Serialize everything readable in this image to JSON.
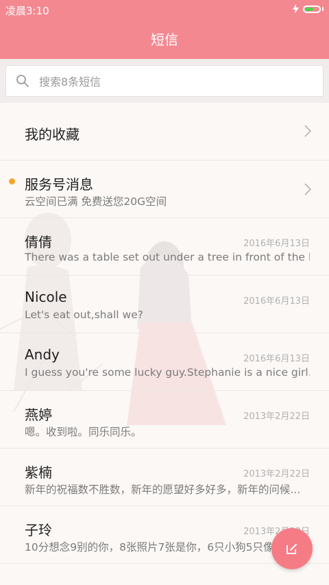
{
  "status_bar": {
    "time": "凌晨3:10",
    "battery_level": 0.55
  },
  "app_bar": {
    "title": "短信"
  },
  "search": {
    "placeholder": "搜索8条短信"
  },
  "favorites": {
    "label": "我的收藏"
  },
  "service": {
    "name": "服务号消息",
    "preview": "云空间已满 免费送您20G空间",
    "unread": true
  },
  "conversations": [
    {
      "name": "倩倩",
      "date": "2016年6月13日",
      "preview": "There was a table set out under a tree in front of the ho..."
    },
    {
      "name": "Nicole",
      "date": "2016年6月13日",
      "preview": "Let's eat out,shall we?"
    },
    {
      "name": "Andy",
      "date": "2016年6月13日",
      "preview": "I guess you're some lucky guy.Stephanie is a nice girl."
    },
    {
      "name": "燕婷",
      "date": "2013年2月22日",
      "preview": "嗯。收到啦。同乐同乐。"
    },
    {
      "name": "紫楠",
      "date": "2013年2月22日",
      "preview": "新年的祝福数不胜数，新年的愿望好多好多，新年的问候..."
    },
    {
      "name": "子玲",
      "date": "2013年2月22日",
      "preview": "10分想念9别的你，8张照片7张是你，6只小狗5只像你"
    }
  ],
  "colors": {
    "accent": "#f38891",
    "fab": "#f57c85",
    "unread_dot": "#f7a52a"
  }
}
